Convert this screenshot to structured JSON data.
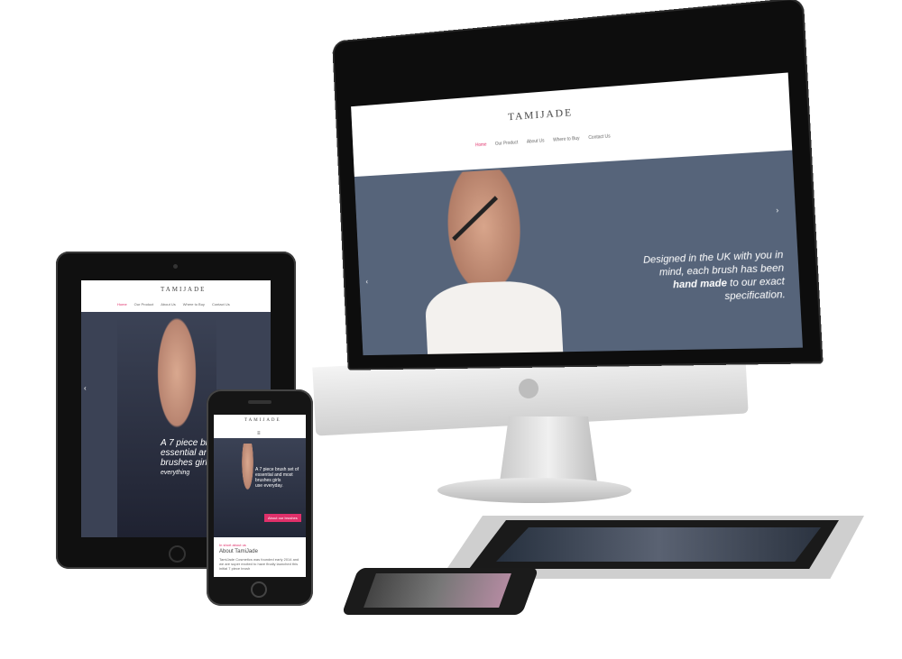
{
  "imac": {
    "logo": "TAMIJADE",
    "nav": [
      "Home",
      "Our Product",
      "About Us",
      "Where to Buy",
      "Contact Us"
    ],
    "hero_line1": "Designed in the UK with you in",
    "hero_line2": "mind, each brush has been",
    "hero_line3": "hand made",
    "hero_line3_rest": " to our exact",
    "hero_line4": "specification."
  },
  "ipad": {
    "logo": "TAMIJADE",
    "nav": [
      "Home",
      "Our Product",
      "About Us",
      "Where to Buy",
      "Contact Us"
    ],
    "hero_line1": "A 7 piece brus",
    "hero_line2": "essential and m",
    "hero_line3": "brushes girls u",
    "hero_line4": "everything"
  },
  "iphone": {
    "logo": "TAMIJADE",
    "hero_line1": "A 7 piece brush set of",
    "hero_line2": "essential and most",
    "hero_line3": "brushes girls",
    "hero_line4": "use everyday.",
    "cta": "About our brushes",
    "section_kicker": "In short about us",
    "section_title": "About TamiJade",
    "section_body": "TamiJade Cosmetics was founded early 2014 and we are super excited to have finally launched this initial 7 piece brush"
  },
  "colors": {
    "accent": "#e0306a"
  }
}
